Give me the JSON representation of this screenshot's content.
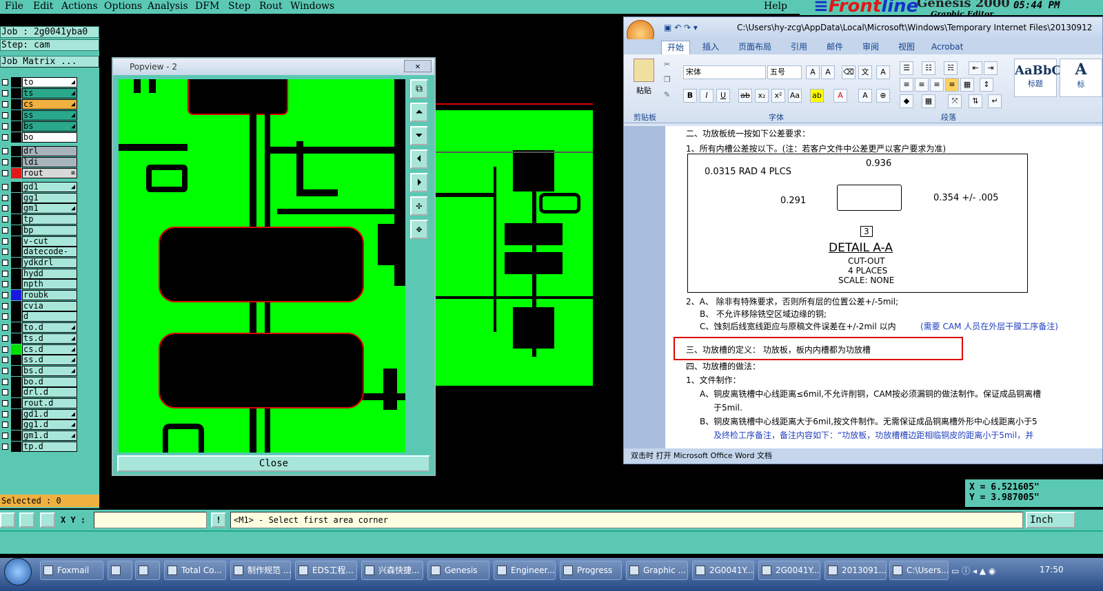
{
  "menu": [
    "File",
    "Edit",
    "Actions",
    "Options",
    "Analysis",
    "DFM",
    "Step",
    "Rout",
    "Windows"
  ],
  "menu_help": "Help",
  "brand": {
    "logo_a": "Front",
    "logo_b": "line",
    "product": "Genesis 2000",
    "subtitle": "Graphic Editor",
    "clock": "05:44 PM"
  },
  "job": "Job : 2g0041yba0",
  "step": "Step: cam",
  "job_matrix": "Job Matrix ...",
  "layers": [
    {
      "name": "to",
      "color": "#ffffff",
      "mark": "◢"
    },
    {
      "name": "ts",
      "color": "#2aa88c",
      "mark": "◢"
    },
    {
      "name": "cs",
      "color": "#f0b040",
      "mark": "◢"
    },
    {
      "name": "ss",
      "color": "#2aa88c",
      "mark": "◢"
    },
    {
      "name": "bs",
      "color": "#2aa88c",
      "mark": "◢"
    },
    {
      "name": "bo",
      "color": "#ffffff",
      "mark": ""
    },
    {
      "name": "drl",
      "color": "#a8b4bc",
      "mark": ""
    },
    {
      "name": "ldi",
      "color": "#a8b4bc",
      "mark": ""
    },
    {
      "name": "rout",
      "color": "#d8d8d8",
      "mark": "≡"
    },
    {
      "name": "gd1",
      "color": "#a8e6da",
      "mark": "◢"
    },
    {
      "name": "gg1",
      "color": "#a8e6da",
      "mark": ""
    },
    {
      "name": "gm1",
      "color": "#a8e6da",
      "mark": "◢"
    },
    {
      "name": "tp",
      "color": "#a8e6da",
      "mark": ""
    },
    {
      "name": "bp",
      "color": "#a8e6da",
      "mark": ""
    },
    {
      "name": "v-cut",
      "color": "#a8e6da",
      "mark": ""
    },
    {
      "name": "datecode-to",
      "color": "#a8e6da",
      "mark": ""
    },
    {
      "name": "ydkdrl",
      "color": "#a8e6da",
      "mark": ""
    },
    {
      "name": "hydd",
      "color": "#a8e6da",
      "mark": ""
    },
    {
      "name": "npth",
      "color": "#a8e6da",
      "mark": ""
    },
    {
      "name": "roubk",
      "color": "#a8e6da",
      "mark": ""
    },
    {
      "name": "cvia",
      "color": "#a8e6da",
      "mark": ""
    },
    {
      "name": "d",
      "color": "#a8e6da",
      "mark": ""
    },
    {
      "name": "to.d",
      "color": "#a8e6da",
      "mark": "◢"
    },
    {
      "name": "ts.d",
      "color": "#a8e6da",
      "mark": "◢"
    },
    {
      "name": "cs.d",
      "color": "#a8e6da",
      "mark": "◢"
    },
    {
      "name": "ss.d",
      "color": "#a8e6da",
      "mark": "◢"
    },
    {
      "name": "bs.d",
      "color": "#a8e6da",
      "mark": "◢"
    },
    {
      "name": "bo.d",
      "color": "#a8e6da",
      "mark": ""
    },
    {
      "name": "drl.d",
      "color": "#a8e6da",
      "mark": ""
    },
    {
      "name": "rout.d",
      "color": "#a8e6da",
      "mark": ""
    },
    {
      "name": "gd1.d",
      "color": "#a8e6da",
      "mark": "◢"
    },
    {
      "name": "gg1.d",
      "color": "#a8e6da",
      "mark": "◢"
    },
    {
      "name": "gm1.d",
      "color": "#a8e6da",
      "mark": "◢"
    },
    {
      "name": "tp.d",
      "color": "#a8e6da",
      "mark": ""
    }
  ],
  "selected": "Selected : 0",
  "popview": {
    "title": "Popview - 2",
    "close": "Close"
  },
  "word": {
    "path": "C:\\Users\\hy-zcg\\AppData\\Local\\Microsoft\\Windows\\Temporary Internet Files\\20130912",
    "tabs": [
      "开始",
      "插入",
      "页面布局",
      "引用",
      "邮件",
      "审阅",
      "视图",
      "Acrobat"
    ],
    "font_name": "宋体",
    "font_size": "五号",
    "groups": {
      "clipboard": "剪贴板",
      "font": "字体",
      "paragraph": "段落",
      "paste": "粘贴"
    },
    "styles": [
      {
        "sample": "AaBbC",
        "label": "标题"
      },
      {
        "sample": "A",
        "label": "标"
      }
    ],
    "status": "双击时 打开 Microsoft Office Word 文档",
    "drawing": {
      "rad": "0.0315 RAD 4 PLCS",
      "w": "0.936",
      "h": "0.291",
      "tol": "0.354 +/- .005",
      "num": "3",
      "detail": "DETAIL A-A",
      "l1": "CUT-OUT",
      "l2": "4 PLACES",
      "l3": "SCALE: NONE"
    },
    "lines": [
      "二、功放板统一按如下公差要求：",
      "1、所有内槽公差按以下。(注：若客户文件中公差更严以客户要求为准)",
      "2、A、  除非有特殊要求，否则所有层的位置公差+/-5mil;",
      "B、  不允许移除铣空区域边缘的铜;",
      "C、蚀刻后线宽线距应与原稿文件误差在+/-2mil 以内",
      "(需要 CAM 人员在外层干膜工序备注)",
      "三、功放槽的定义：  功放板，板内内槽都为功放槽",
      "四、功放槽的做法：",
      "1、文件制作：",
      "A、铜皮离铣槽中心线距离≤6mil,不允许削铜，CAM按必须漏铜的做法制作。保证成品铜离槽",
      "于5mil.",
      "B、铜皮离铣槽中心线距离大于6mil,按文件制作。无需保证成品铜离槽外形中心线距离小于5",
      "及终检工序备注，备注内容如下：“功放板，功放槽槽边距相临铜皮的距离小于5mil，并"
    ]
  },
  "coords": {
    "x": "X = 6.521605\"",
    "y": "Y = 3.987005\""
  },
  "cmd": {
    "xy_label": "X Y :",
    "message": "<M1> - Select first area corner",
    "units": "Inch"
  },
  "taskbar": [
    "Foxmail",
    "",
    "",
    "Total Co...",
    "制作规范 ...",
    "EDS工程...",
    "兴森快捷...",
    "Genesis",
    "Engineer...",
    "Progress",
    "Graphic ...",
    "2G0041Y...",
    "2G0041Y...",
    "2013091...",
    "C:\\Users..."
  ],
  "tray_time": "17:50"
}
